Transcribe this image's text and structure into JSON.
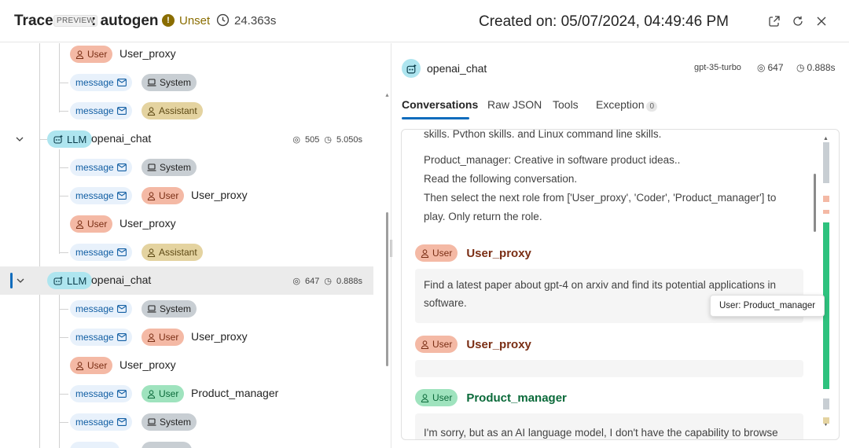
{
  "header": {
    "title": "Trace",
    "preview_badge": "PREVIEW",
    "trace_name": ": autogen",
    "status": "Unset",
    "duration": "24.363s",
    "created": "Created on: 05/07/2024, 04:49:46 PM"
  },
  "tree": {
    "labels": {
      "user": "User",
      "message": "message",
      "system": "System",
      "assistant": "Assistant",
      "llm": "LLM"
    },
    "rows": [
      {
        "name": "User_proxy"
      },
      {
        "name": "openai_chat",
        "tokens": "505",
        "latency": "5.050s"
      },
      {
        "name": "User_proxy"
      },
      {
        "name": "User_proxy"
      },
      {
        "name": "openai_chat",
        "tokens": "647",
        "latency": "0.888s"
      },
      {
        "name": "User_proxy"
      },
      {
        "name": "User_proxy"
      },
      {
        "name": "Product_manager"
      }
    ]
  },
  "detail": {
    "name": "openai_chat",
    "model": "gpt-35-turbo",
    "tokens": "647",
    "latency": "0.888s",
    "tabs": [
      {
        "label": "Conversations"
      },
      {
        "label": "Raw JSON"
      },
      {
        "label": "Tools"
      },
      {
        "label": "Exception",
        "count": "0"
      }
    ],
    "conversation": {
      "lines": [
        "skills, Python skills, and Linux command line skills.",
        "Product_manager: Creative in software product ideas..",
        "Read the following conversation.",
        "Then select the next role from ['User_proxy', 'Coder', 'Product_manager'] to",
        "play. Only return the role."
      ],
      "messages": [
        {
          "role": "User",
          "name": "User_proxy",
          "text1": "Find a latest paper about gpt-4 on arxiv and find its potential applications in",
          "text2": "software."
        },
        {
          "role": "User",
          "name": "User_proxy",
          "text1": ""
        },
        {
          "role": "User",
          "name": "Product_manager",
          "text1": "I'm sorry, but as an AI language model, I don't have the capability to browse"
        }
      ],
      "tooltip": "User: Product_manager"
    }
  },
  "colors": {
    "accent": "#0f6cbd",
    "status": "#8a6d00",
    "user_pill": "#f4b9a5",
    "user_pill_green": "#9fe3be",
    "llm_pill": "#aee5ef"
  }
}
